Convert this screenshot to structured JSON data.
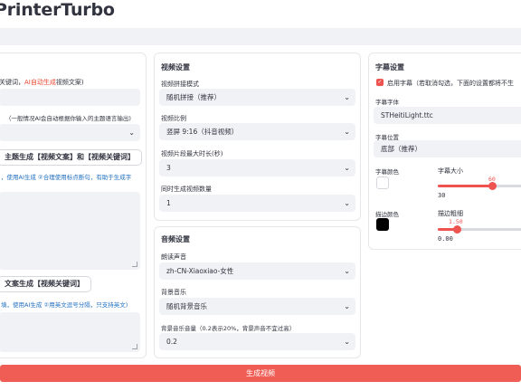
{
  "app": {
    "title": "PrinterTurbo"
  },
  "script_panel": {
    "keywords_label_a": "关键词，",
    "keywords_label_b": "AI自动生成",
    "keywords_label_c": "视频文案)",
    "language_hint": "（一般情况AI会自动根据你输入的主题语言输出)",
    "generate_script_button": "主题生成【视频文案】和【视频关键词】",
    "tip1": "，使用AI生成 ②合理使用标点断句，有助于生成字",
    "generate_keywords_button": "文案生成【视频关键词】",
    "tip2": "填，使用AI生成 ②用英文逗号分隔，只支持英文)"
  },
  "video_settings": {
    "heading": "视频设置",
    "concat_mode_label": "视频拼接模式",
    "concat_mode_value": "随机拼接（推荐）",
    "aspect_label": "视频比例",
    "aspect_value": "竖屏 9:16（抖音视频）",
    "clip_duration_label": "视频片段最大时长(秒)",
    "clip_duration_value": "3",
    "count_label": "同时生成视频数量",
    "count_value": "1"
  },
  "audio_settings": {
    "heading": "音频设置",
    "voice_label": "朗读声音",
    "voice_value": "zh-CN-Xiaoxiao-女性",
    "bgm_label": "背景音乐",
    "bgm_value": "随机背景音乐",
    "bgm_volume_label": "背景音乐音量（0.2表示20%，背景声音不宜过高）",
    "bgm_volume_value": "0.2"
  },
  "subtitle_settings": {
    "heading": "字幕设置",
    "enable_label": "启用字幕（若取消勾选，下面的设置都将不生",
    "font_label": "字幕字体",
    "font_value": "STHeitiLight.ttc",
    "position_label": "字幕位置",
    "position_value": "底部（推荐）",
    "font_color_label": "字幕颜色",
    "font_color": "#ffffff",
    "font_size_label": "字幕大小",
    "font_size_min": "30",
    "font_size_value": "60",
    "stroke_color_label": "描边颜色",
    "stroke_color": "#000000",
    "stroke_width_label": "描边粗细",
    "stroke_width_min": "0.00",
    "stroke_width_value": "1.50"
  },
  "footer": {
    "generate_button": "生成视频"
  },
  "colors": {
    "accent": "#ef5350",
    "hint": "#1f6fc1",
    "field_bg": "#f0f2f6"
  },
  "icons": {
    "dropdown": "chevron-down-icon",
    "checkbox": "check-icon"
  }
}
